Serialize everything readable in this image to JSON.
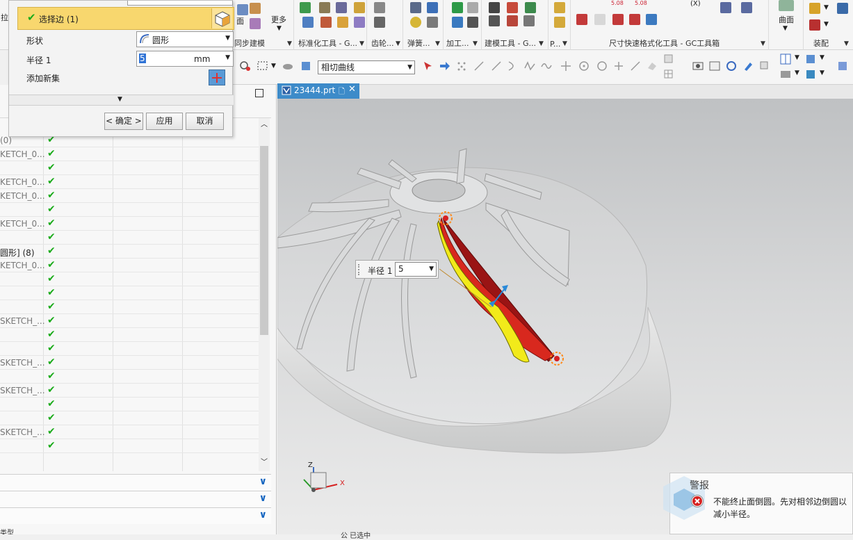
{
  "ribbon": {
    "groups": [
      "同步建模",
      "标准化工具 - G...",
      "齿轮...",
      "弹簧...",
      "加工...",
      "建模工具 - G...",
      "P...",
      "尺寸快速格式化工具 - GC工具箱",
      "装配"
    ],
    "more_label": "更多",
    "surface_label": "曲面",
    "top_left_label": "面",
    "top_left_label2": "拉",
    "dim_tags": [
      "5.08",
      "5.08",
      "(X)"
    ]
  },
  "toolbar2": {
    "curve_rule": "相切曲线",
    "dropdown_arrow": "▼"
  },
  "dialog": {
    "select_edge": "选择边 (1)",
    "shape_label": "形状",
    "shape_value": "圆形",
    "radius_label": "半径 1",
    "radius_value": "5",
    "radius_unit": "mm",
    "add_new_set": "添加新集",
    "ok_button": "< 确定 >",
    "apply_button": "应用",
    "cancel_button": "取消"
  },
  "part_tab": {
    "name": "23444.prt"
  },
  "tree": {
    "rows": [
      {
        "name": "(0)",
        "check": true
      },
      {
        "name": "KETCH_0...",
        "check": true
      },
      {
        "name": "",
        "check": true
      },
      {
        "name": "KETCH_0...",
        "check": true
      },
      {
        "name": "KETCH_0...",
        "check": true
      },
      {
        "name": "",
        "check": true
      },
      {
        "name": "KETCH_0...",
        "check": true
      },
      {
        "name": "",
        "check": true
      },
      {
        "name": "圆形] (8)",
        "check": true
      },
      {
        "name": "KETCH_0...",
        "check": true
      },
      {
        "name": "",
        "check": true
      },
      {
        "name": "",
        "check": true
      },
      {
        "name": "",
        "check": true
      },
      {
        "name": "SKETCH_...",
        "check": true
      },
      {
        "name": "",
        "check": true
      },
      {
        "name": "",
        "check": true
      },
      {
        "name": "SKETCH_...",
        "check": true
      },
      {
        "name": "",
        "check": true
      },
      {
        "name": "SKETCH_...",
        "check": true
      },
      {
        "name": "",
        "check": true
      },
      {
        "name": "",
        "check": true
      },
      {
        "name": "SKETCH_...",
        "check": true
      },
      {
        "name": "",
        "check": true
      }
    ]
  },
  "hud": {
    "label": "半径 1",
    "value": "5"
  },
  "warning": {
    "title": "警报",
    "message_line1": "不能终止面倒圆。先对相邻边倒圆以",
    "message_line2": "减小半径。"
  },
  "triad": {
    "x": "X",
    "z": "Z"
  },
  "colors": {
    "selection_yellow": "#f8d76e",
    "tab_blue": "#3d8bc9",
    "fillet_yellow": "#f2ea1a",
    "fillet_red": "#d8281e",
    "check_green": "#1aab1a"
  },
  "bottom_text": [
    "类型",
    "公 已选中"
  ]
}
